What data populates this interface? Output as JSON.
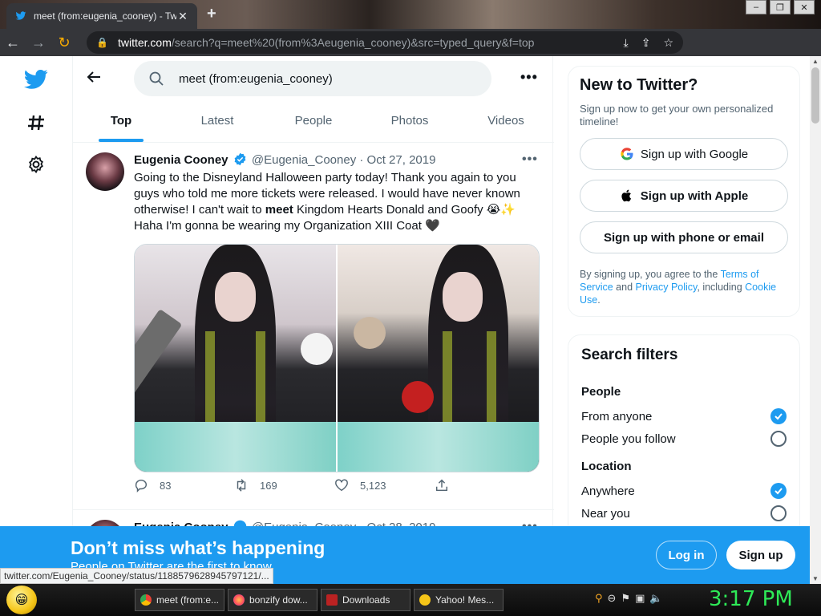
{
  "browser": {
    "tab_title": "meet (from:eugenia_cooney) - Tw",
    "url_host": "twitter.com",
    "url_path": "/search?q=meet%20(from%3Aeugenia_cooney)&src=typed_query&f=top",
    "status_url": "twitter.com/Eugenia_Cooney/status/1188579628945797121/...",
    "accent": "#f9ab00"
  },
  "search": {
    "query": "meet (from:eugenia_cooney)"
  },
  "tabs": [
    "Top",
    "Latest",
    "People",
    "Photos",
    "Videos"
  ],
  "tweet": {
    "name": "Eugenia Cooney",
    "handle": "@Eugenia_Cooney",
    "dot": "·",
    "date": "Oct 27, 2019",
    "text_before": "Going to the Disneyland Halloween party today! Thank you again to you guys who told me more tickets were released. I would have never known otherwise! I can't wait to ",
    "text_bold": "meet",
    "text_after": " Kingdom Hearts Donald and Goofy 😭✨ Haha I'm gonna be wearing my Organization XIII Coat 🖤",
    "replies": "83",
    "retweets": "169",
    "likes": "5,123"
  },
  "tweet2": {
    "name": "Eugenia Cooney",
    "handle": "@Eugenia_Cooney",
    "date": "Oct 28, 2019"
  },
  "sidebar": {
    "new_title": "New to Twitter?",
    "new_sub": "Sign up now to get your own personalized timeline!",
    "google": "Sign up with Google",
    "apple": "Sign up with Apple",
    "phone": "Sign up with phone or email",
    "legal_1": "By signing up, you agree to the ",
    "legal_terms": "Terms of Service",
    "legal_2": " and ",
    "legal_privacy": "Privacy Policy",
    "legal_3": ", including ",
    "legal_cookie": "Cookie Use",
    "legal_4": ".",
    "filters_title": "Search filters",
    "people_title": "People",
    "from_anyone": "From anyone",
    "people_follow": "People you follow",
    "location_title": "Location",
    "anywhere": "Anywhere",
    "near_you": "Near you"
  },
  "banner": {
    "headline": "Don’t miss what’s happening",
    "sub": "People on Twitter are the first to know.",
    "login": "Log in",
    "signup": "Sign up",
    "color": "#1d9bf0"
  },
  "taskbar": {
    "items": [
      "meet (from:e...",
      "bonzify dow...",
      "Downloads",
      "Yahoo! Mes..."
    ],
    "clock": "3:17 PM"
  }
}
